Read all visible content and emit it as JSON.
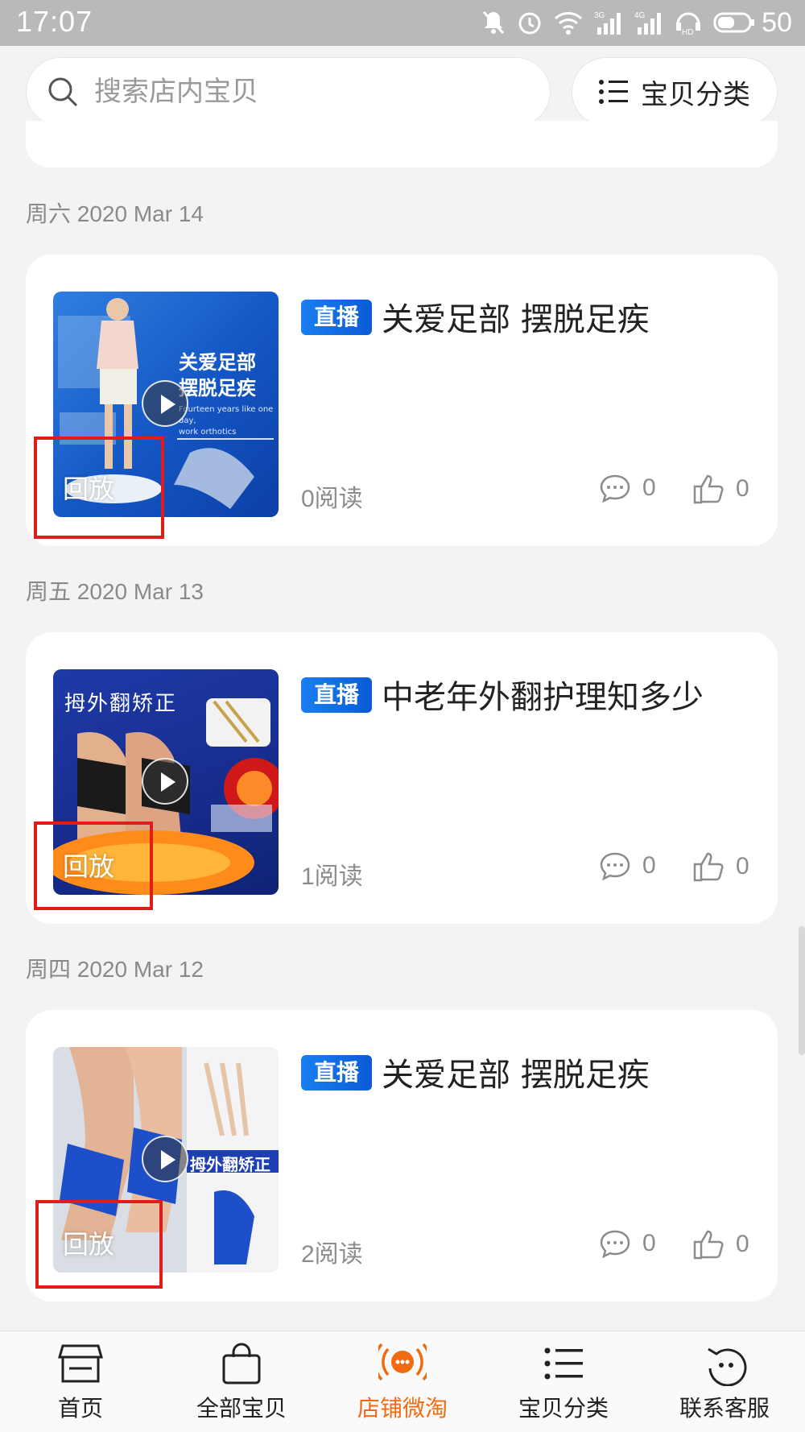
{
  "status_bar": {
    "time": "17:07",
    "battery": "50",
    "icons": [
      "mute-icon",
      "alarm-icon",
      "wifi-icon",
      "signal-3g-icon",
      "signal-4g-icon",
      "hd-icon",
      "battery-icon"
    ]
  },
  "search": {
    "placeholder": "搜索店内宝贝"
  },
  "category_button": {
    "label": "宝贝分类"
  },
  "feed": [
    {
      "date": "周六 2020 Mar 14",
      "tag": "直播",
      "title": "关爱足部 摆脱足疾",
      "reads": "0阅读",
      "comments": "0",
      "likes": "0",
      "replay": "回放",
      "thumb_text": [
        "关爱足部",
        "摆脱足疾",
        "Fourteen years like one day,",
        "work orthotics"
      ]
    },
    {
      "date": "周五 2020 Mar 13",
      "tag": "直播",
      "title": "中老年外翻护理知多少",
      "reads": "1阅读",
      "comments": "0",
      "likes": "0",
      "replay": "回放",
      "thumb_text": [
        "拇外翻矫正"
      ]
    },
    {
      "date": "周四 2020 Mar 12",
      "tag": "直播",
      "title": "关爱足部 摆脱足疾",
      "reads": "2阅读",
      "comments": "0",
      "likes": "0",
      "replay": "回放",
      "thumb_text": [
        "拇外翻矫正"
      ]
    }
  ],
  "tabs": [
    {
      "label": "首页",
      "icon": "store-icon",
      "active": false
    },
    {
      "label": "全部宝贝",
      "icon": "bag-icon",
      "active": false
    },
    {
      "label": "店铺微淘",
      "icon": "broadcast-icon",
      "active": true
    },
    {
      "label": "宝贝分类",
      "icon": "list-icon",
      "active": false
    },
    {
      "label": "联系客服",
      "icon": "chat-face-icon",
      "active": false
    }
  ],
  "colors": {
    "accent": "#f26a10",
    "live_tag": "#1a7ff0",
    "highlight": "#e21b1b"
  }
}
